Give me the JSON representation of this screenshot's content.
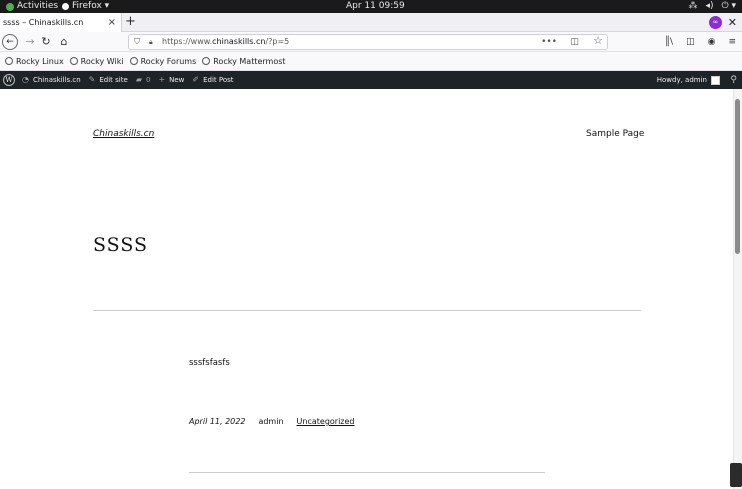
{
  "gnome": {
    "activities": "Activities",
    "app": "Firefox ▾",
    "clock": "Apr 11  09:59"
  },
  "browser": {
    "tab_title": "ssss – Chinaskills.cn",
    "tab_close": "×",
    "new_tab": "+",
    "url_prefix": "https://www.",
    "url_domain": "chinaskills.cn",
    "url_suffix": "/?p=5",
    "url_menu": "•••",
    "bookmarks": [
      {
        "label": "Rocky Linux"
      },
      {
        "label": "Rocky Wiki"
      },
      {
        "label": "Rocky Forums"
      },
      {
        "label": "Rocky Mattermost"
      }
    ]
  },
  "wpbar": {
    "site": "Chinaskills.cn",
    "edit_site": "Edit site",
    "comments": "0",
    "new": "New",
    "edit_post": "Edit Post",
    "howdy": "Howdy, admin"
  },
  "page": {
    "site_title": "Chinaskills.cn",
    "nav_link": "Sample Page",
    "post_title": "ssss",
    "content": "sssfsfasfs",
    "date": "April 11, 2022",
    "author": "admin",
    "category": "Uncategorized"
  }
}
